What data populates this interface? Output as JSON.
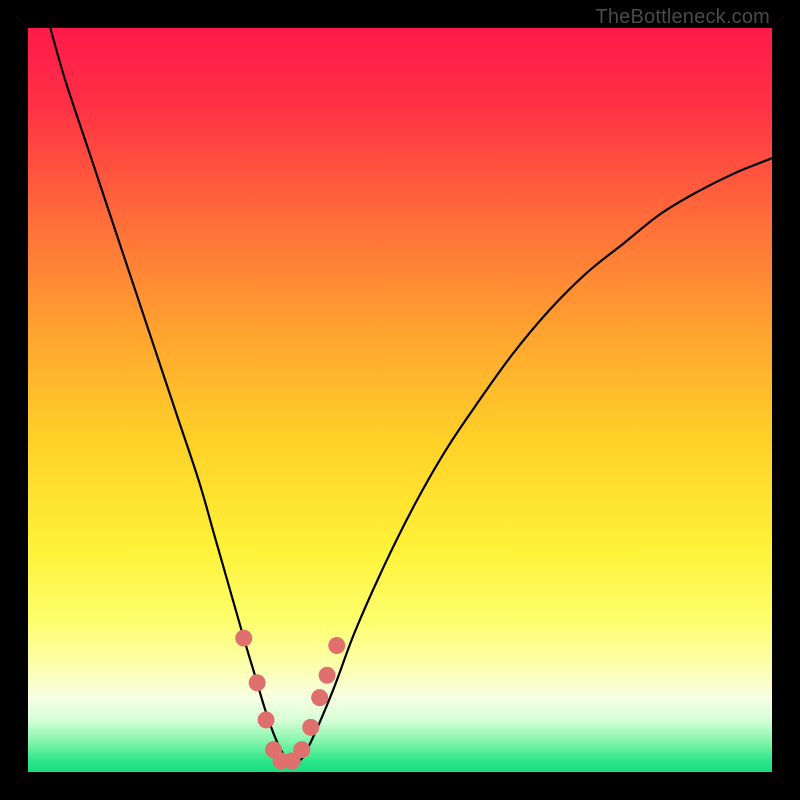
{
  "watermark": "TheBottleneck.com",
  "chart_data": {
    "type": "line",
    "title": "",
    "xlabel": "",
    "ylabel": "",
    "xlim": [
      0,
      100
    ],
    "ylim": [
      0,
      100
    ],
    "gradient_stops": [
      {
        "offset": 0.0,
        "color": "#ff1a4a"
      },
      {
        "offset": 0.1,
        "color": "#ff2f45"
      },
      {
        "offset": 0.25,
        "color": "#ff6a3a"
      },
      {
        "offset": 0.4,
        "color": "#ffa030"
      },
      {
        "offset": 0.55,
        "color": "#ffd028"
      },
      {
        "offset": 0.7,
        "color": "#fff238"
      },
      {
        "offset": 0.8,
        "color": "#feff70"
      },
      {
        "offset": 0.86,
        "color": "#fdffb0"
      },
      {
        "offset": 0.9,
        "color": "#f6ffe2"
      },
      {
        "offset": 0.93,
        "color": "#d8ffd8"
      },
      {
        "offset": 0.96,
        "color": "#80f5a8"
      },
      {
        "offset": 0.985,
        "color": "#2de58a"
      },
      {
        "offset": 1.0,
        "color": "#18dd80"
      }
    ],
    "series": [
      {
        "name": "bottleneck-curve",
        "x": [
          3,
          5,
          8,
          11,
          14,
          17,
          20,
          23,
          25,
          27,
          29,
          30.5,
          32,
          33.5,
          35,
          36.5,
          38,
          41,
          44,
          48,
          52,
          56,
          60,
          65,
          70,
          75,
          80,
          85,
          90,
          95,
          100
        ],
        "y": [
          100,
          93,
          84,
          75,
          66,
          57,
          48,
          39,
          32,
          25,
          18,
          13,
          8,
          4,
          1.5,
          1.5,
          4,
          11,
          19,
          28,
          36,
          43,
          49,
          56,
          62,
          67,
          71,
          75,
          78,
          80.5,
          82.5
        ]
      }
    ],
    "markers": {
      "name": "highlight-dots",
      "color": "#e0706e",
      "points": [
        {
          "x": 29.0,
          "y": 18
        },
        {
          "x": 30.8,
          "y": 12
        },
        {
          "x": 32.0,
          "y": 7
        },
        {
          "x": 33.0,
          "y": 3
        },
        {
          "x": 34.0,
          "y": 1.5
        },
        {
          "x": 35.5,
          "y": 1.5
        },
        {
          "x": 36.8,
          "y": 3
        },
        {
          "x": 38.0,
          "y": 6
        },
        {
          "x": 39.2,
          "y": 10
        },
        {
          "x": 40.2,
          "y": 13
        },
        {
          "x": 41.5,
          "y": 17
        }
      ]
    }
  }
}
